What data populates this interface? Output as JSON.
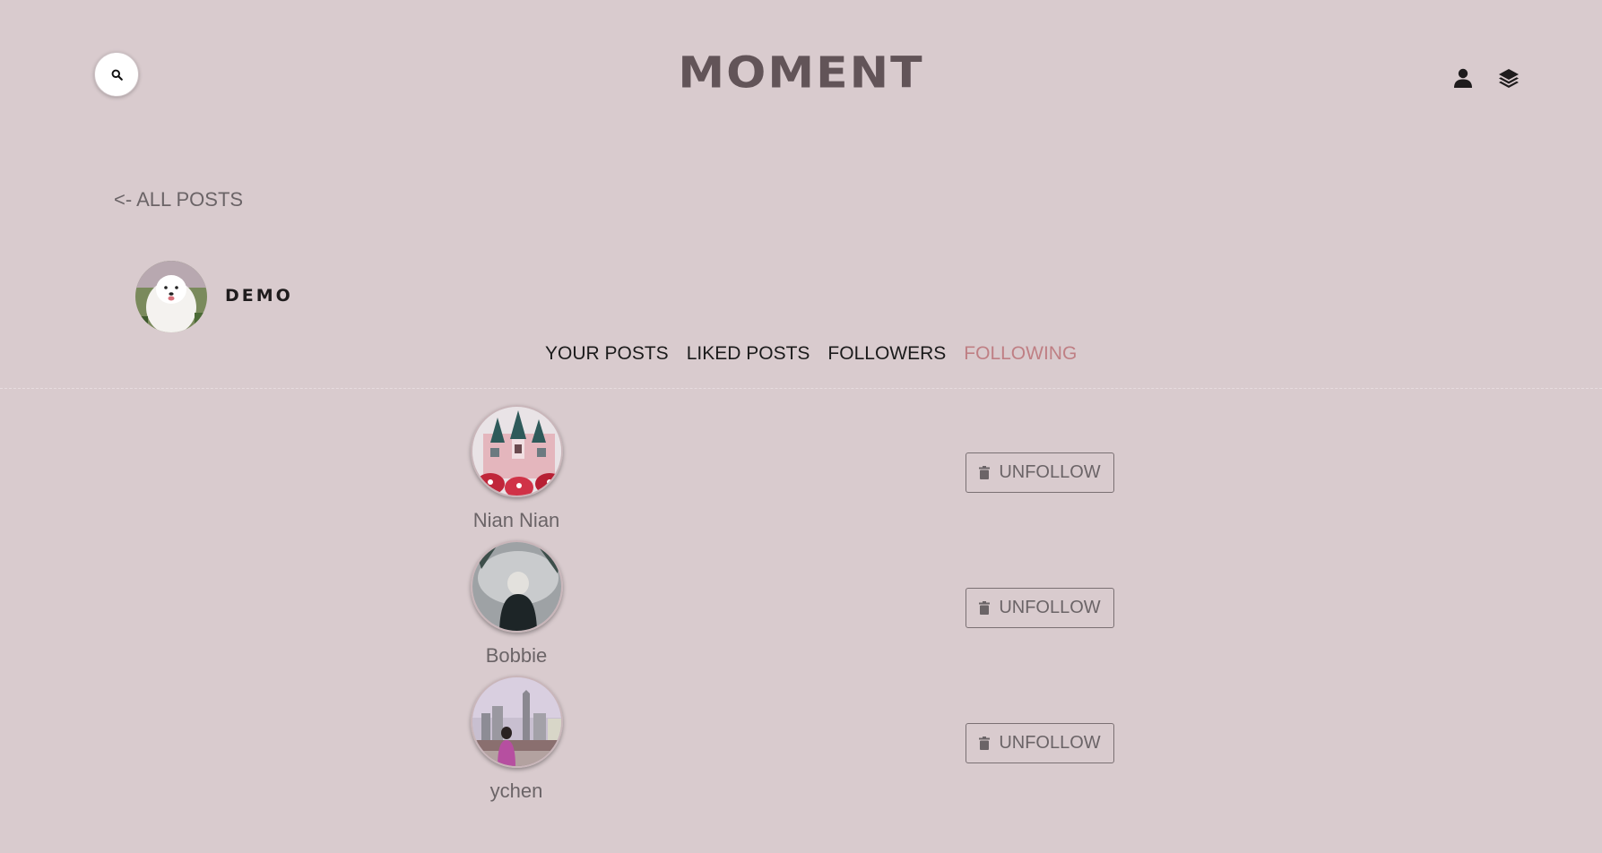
{
  "header": {
    "logo_text": "MOMENT",
    "search_icon": "search-icon",
    "user_icon": "user-icon",
    "layers_icon": "layers-icon"
  },
  "nav": {
    "back_label": "<- ALL POSTS"
  },
  "profile": {
    "username": "DEMO"
  },
  "tabs": [
    {
      "label": "YOUR POSTS",
      "active": false
    },
    {
      "label": "LIKED POSTS",
      "active": false
    },
    {
      "label": "FOLLOWERS",
      "active": false
    },
    {
      "label": "FOLLOWING",
      "active": true
    }
  ],
  "following": [
    {
      "name": "Nian Nian",
      "button_label": "UNFOLLOW",
      "button_icon": "trash-icon"
    },
    {
      "name": "Bobbie",
      "button_label": "UNFOLLOW",
      "button_icon": "trash-icon"
    },
    {
      "name": "ychen",
      "button_label": "UNFOLLOW",
      "button_icon": "trash-icon"
    }
  ],
  "colors": {
    "background": "#d9cbce",
    "active_tab": "#bf7f84",
    "logo": "#625458"
  }
}
